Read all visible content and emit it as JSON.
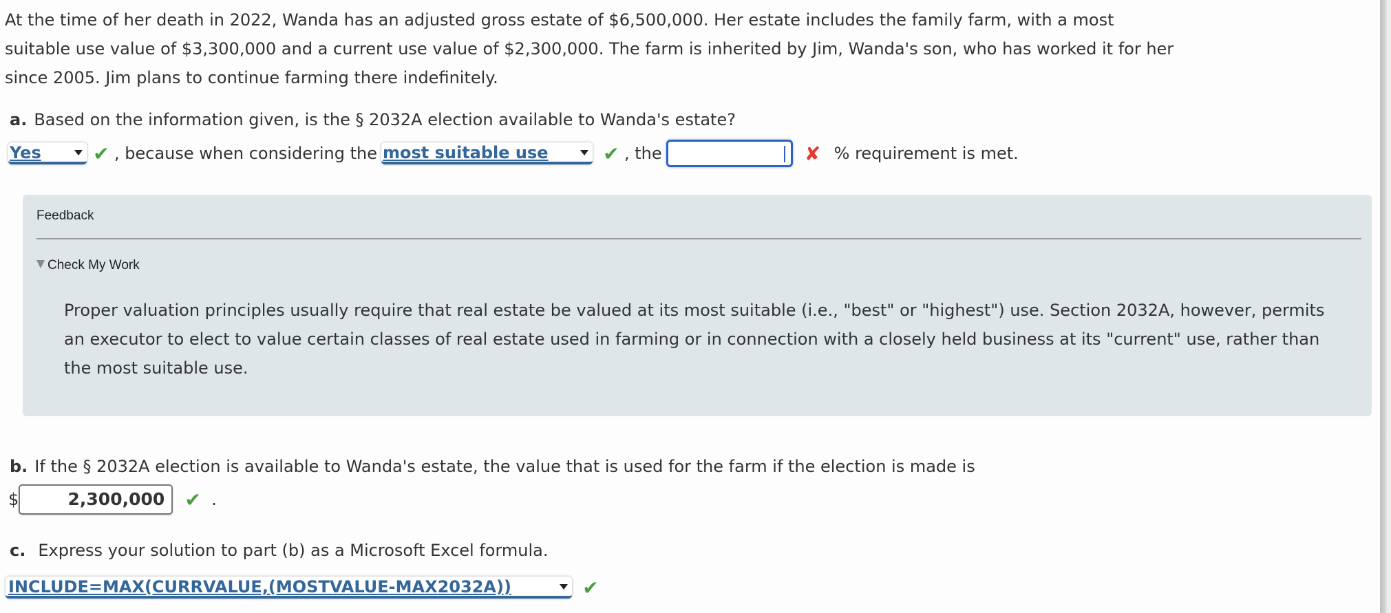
{
  "intro": "At the time of her death in 2022, Wanda has an adjusted gross estate of $6,500,000. Her estate includes the family farm, with a most suitable use value of $3,300,000 and a current use value of $2,300,000. The farm is inherited by Jim, Wanda's son, who has worked it for her since 2005. Jim plans to continue farming there indefinitely.",
  "part_a": {
    "label": "a.",
    "question": "Based on the information given, is the § 2032A election available to Wanda's estate?",
    "select1_value": "Yes",
    "text1": ", because when considering the",
    "select2_value": "most suitable use",
    "text2": ", the",
    "pct_input_value": "",
    "text3": "% requirement is met.",
    "status1": "correct",
    "status2": "correct",
    "status3": "incorrect"
  },
  "feedback": {
    "title": "Feedback",
    "toggle_label": "Check My Work",
    "body": "Proper valuation principles usually require that real estate be valued at its most suitable (i.e., \"best\" or \"highest\") use. Section 2032A, however, permits an executor to elect to value certain classes of real estate used in farming or in connection with a closely held business at its \"current\" use, rather than the most suitable use."
  },
  "part_b": {
    "label": "b.",
    "question": "If the § 2032A election is available to Wanda's estate, the value that is used for the farm if the election is made is",
    "currency": "$",
    "value": "2,300,000",
    "trailing": ".",
    "status": "correct"
  },
  "part_c": {
    "label": "c.",
    "question": "Express your solution to part (b) as a Microsoft Excel formula.",
    "select_value": "INCLUDE=MAX(CURRVALUE,(MOSTVALUE-MAX2032A))",
    "status": "correct"
  },
  "icons": {
    "check": "✔",
    "cross": "✘"
  },
  "colors": {
    "link_blue": "#336699",
    "correct_green": "#4a9e3f",
    "incorrect_red": "#e53a2f",
    "focus_blue": "#2f62c2",
    "feedback_bg": "#dfe6ea"
  }
}
